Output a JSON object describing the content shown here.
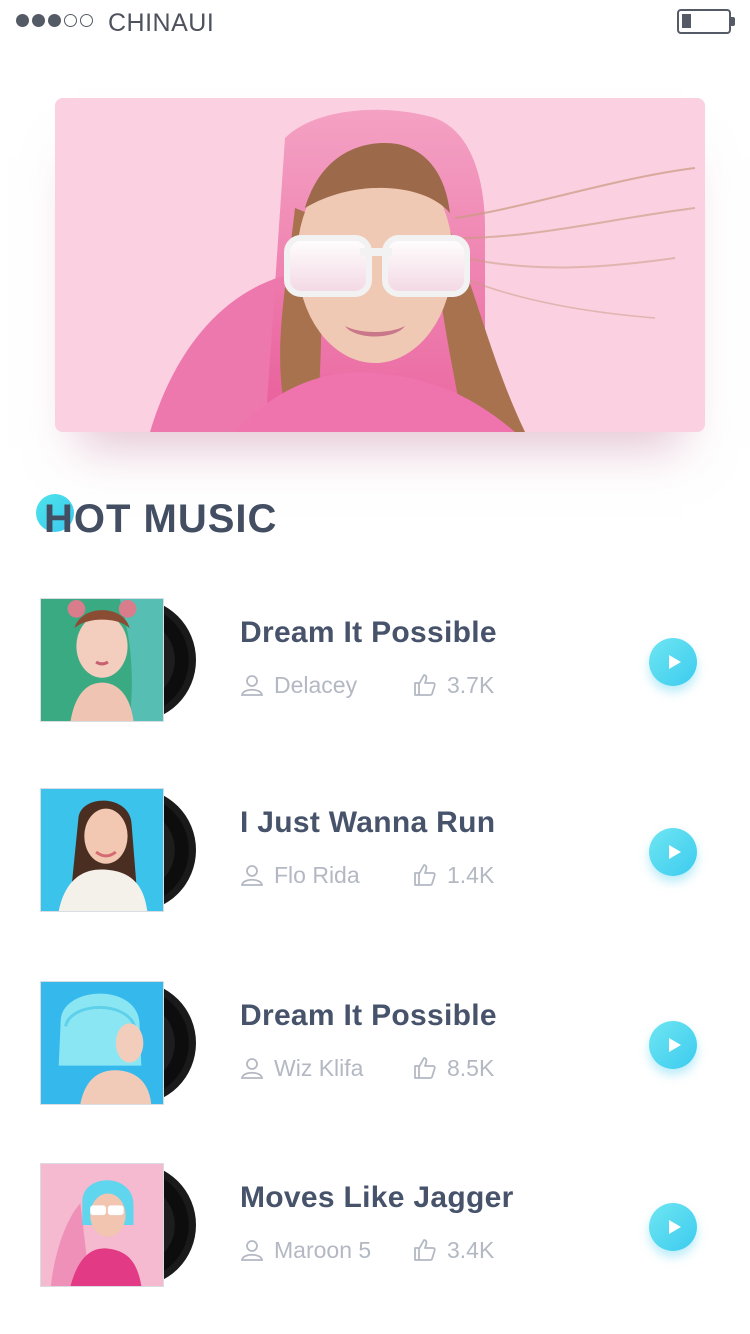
{
  "status_bar": {
    "carrier": "CHINAUI",
    "signal_bars_filled": 3,
    "signal_bars_total": 5,
    "battery_level": 0.2
  },
  "section": {
    "title": "HOT MUSIC"
  },
  "colors": {
    "accent": "#3ccbef",
    "title_text": "#434e63",
    "meta_text": "#b3b8c2",
    "hero_bg": "#f9c7da"
  },
  "songs": [
    {
      "title": "Dream It Possible",
      "artist": "Delacey",
      "likes": "3.7K",
      "cover_bg": "#3aaa82"
    },
    {
      "title": "I Just Wanna Run",
      "artist": "Flo Rida",
      "likes": "1.4K",
      "cover_bg": "#3cc3ec"
    },
    {
      "title": "Dream It Possible",
      "artist": "Wiz Klifa",
      "likes": "8.5K",
      "cover_bg": "#35b8ec"
    },
    {
      "title": "Moves Like Jagger",
      "artist": "Maroon 5",
      "likes": "3.4K",
      "cover_bg": "#f5b9d0"
    }
  ],
  "icons": {
    "artist": "user-icon",
    "likes": "thumbs-up-icon",
    "play": "play-icon"
  }
}
